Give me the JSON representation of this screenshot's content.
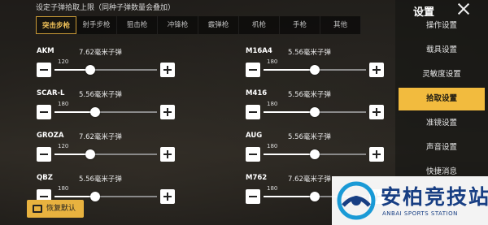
{
  "header": {
    "note": "设定子弹拾取上限（同种子弹数量会叠加）"
  },
  "tabs": [
    "突击步枪",
    "射手步枪",
    "狙击枪",
    "冲锋枪",
    "霰弹枪",
    "机枪",
    "手枪",
    "其他"
  ],
  "active_tab": 0,
  "weapons": [
    {
      "name": "AKM",
      "ammo": "7.62毫米子弹",
      "value": "120",
      "level": 0.35
    },
    {
      "name": "M16A4",
      "ammo": "5.56毫米子弹",
      "value": "180",
      "level": 0.5
    },
    {
      "name": "SCAR-L",
      "ammo": "5.56毫米子弹",
      "value": "180",
      "level": 0.4
    },
    {
      "name": "M416",
      "ammo": "5.56毫米子弹",
      "value": "180",
      "level": 0.5
    },
    {
      "name": "GROZA",
      "ammo": "7.62毫米子弹",
      "value": "120",
      "level": 0.35
    },
    {
      "name": "AUG",
      "ammo": "5.56毫米子弹",
      "value": "180",
      "level": 0.5
    },
    {
      "name": "QBZ",
      "ammo": "5.56毫米子弹",
      "value": "180",
      "level": 0.4
    },
    {
      "name": "M762",
      "ammo": "7.62毫米子弹",
      "value": "180",
      "level": 0.5
    }
  ],
  "restore_label": "恢复默认",
  "sidebar": {
    "title": "设置",
    "items": [
      "操作设置",
      "载具设置",
      "灵敏度设置",
      "拾取设置",
      "准镜设置",
      "声音设置",
      "快捷消息"
    ],
    "active": 3
  },
  "watermark": {
    "cn": "安柏竞技站",
    "en": "ANBAI SPORTS STATION"
  },
  "colors": {
    "accent": "#f2bb3e",
    "watermark": "#173e83"
  }
}
